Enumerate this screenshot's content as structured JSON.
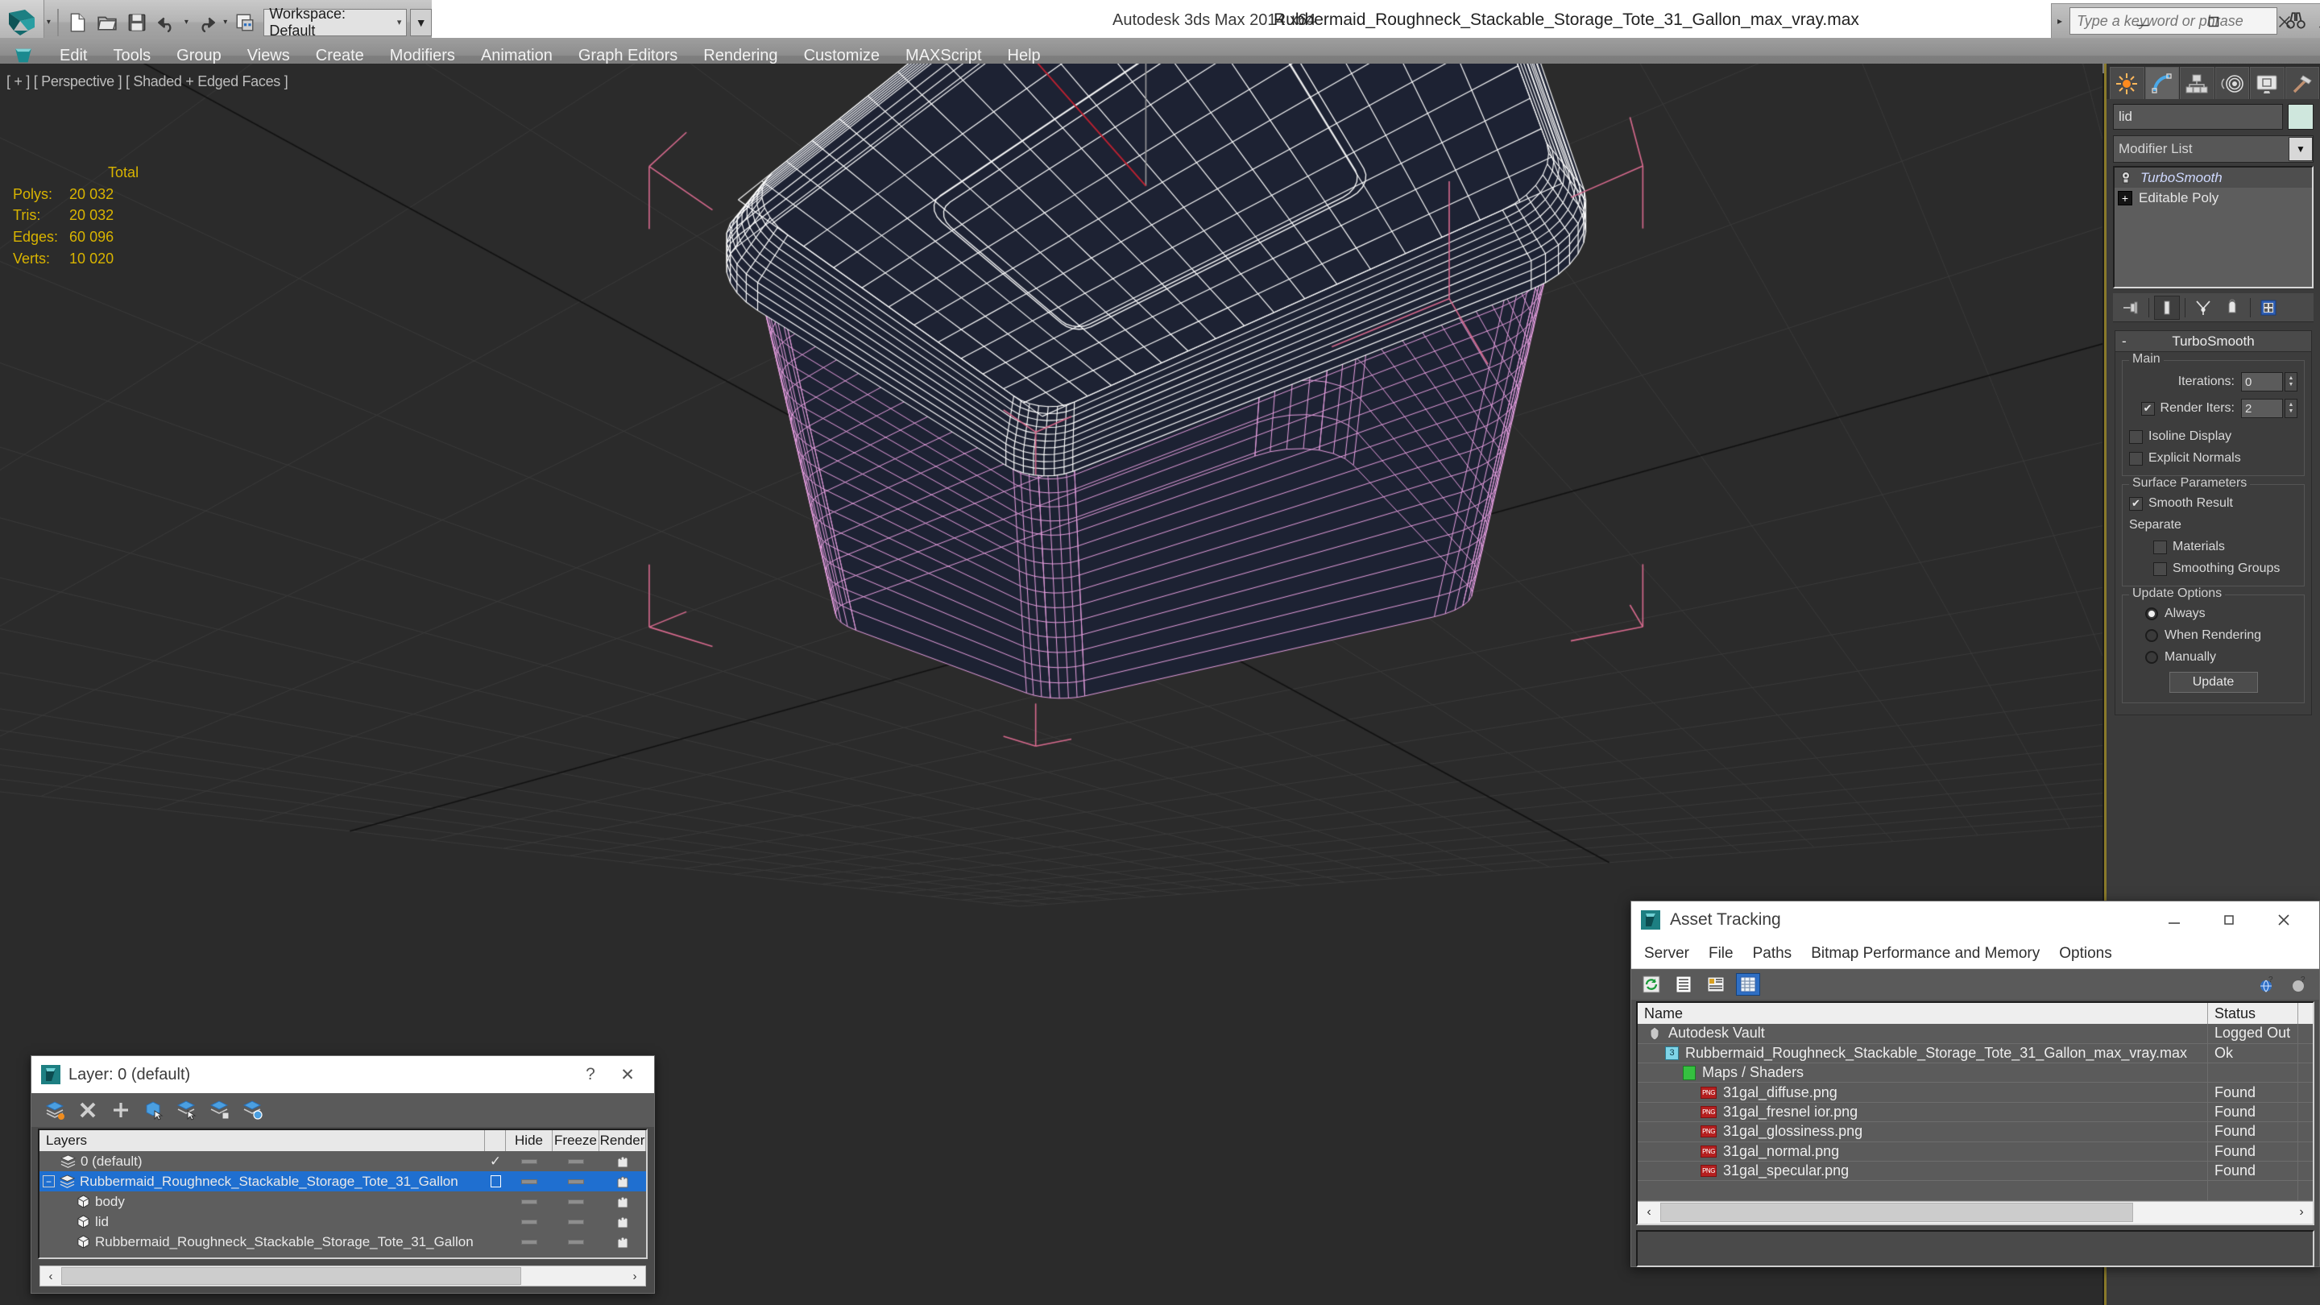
{
  "titlebar": {
    "workspace_label": "Workspace: Default",
    "app_name": "Autodesk 3ds Max  2014 x64",
    "file_name": "Rubbermaid_Roughneck_Stackable_Storage_Tote_31_Gallon_max_vray.max",
    "search_placeholder": "Type a keyword or phrase",
    "quick_access": [
      "new-icon",
      "open-icon",
      "save-icon",
      "undo-icon",
      "redo-icon",
      "set-project-icon"
    ],
    "help_icons": [
      "binoculars-icon",
      "wrench-icon",
      "satellite-icon",
      "star-icon",
      "help-icon"
    ],
    "window_controls": [
      "minimize",
      "maximize",
      "close"
    ]
  },
  "menubar": {
    "items": [
      "Edit",
      "Tools",
      "Group",
      "Views",
      "Create",
      "Modifiers",
      "Animation",
      "Graph Editors",
      "Rendering",
      "Customize",
      "MAXScript",
      "Help"
    ]
  },
  "viewport": {
    "label": "[ + ] [ Perspective ] [ Shaded + Edged Faces ]",
    "stats_header": "Total",
    "stats": [
      {
        "label": "Polys:",
        "value": "20 032"
      },
      {
        "label": "Tris:",
        "value": "20 032"
      },
      {
        "label": "Edges:",
        "value": "60 096"
      },
      {
        "label": "Verts:",
        "value": "10 020"
      }
    ],
    "colors": {
      "background": "#2b2b2b",
      "grid": "#3a3a3a",
      "selected_wire": "#ffffff",
      "object_wire": "#e79fe0",
      "surface": "#1d2233",
      "stats_text": "#d9b400",
      "gizmo_z": "#9a9a9a",
      "gizmo_y": "#c02030"
    }
  },
  "command_panel": {
    "tabs": [
      "create-icon",
      "modify-icon",
      "hierarchy-icon",
      "motion-icon",
      "display-icon",
      "utilities-icon"
    ],
    "active_tab_index": 1,
    "object_name": "lid",
    "object_color": "#cfe7dd",
    "modifier_list_label": "Modifier List",
    "stack": [
      {
        "label": "TurboSmooth",
        "selected": true,
        "icon": "lightbulb-icon"
      },
      {
        "label": "Editable Poly",
        "selected": false,
        "icon": "plus-box-icon"
      }
    ],
    "stack_buttons": [
      "pin-stack-icon",
      "show-end-result-icon",
      "make-unique-icon",
      "remove-modifier-icon",
      "configure-sets-icon"
    ],
    "rollout": {
      "title": "TurboSmooth",
      "collapse_glyph": "-",
      "groups": [
        {
          "title": "Main",
          "fields": [
            {
              "type": "spinner",
              "label": "Iterations:",
              "value": "0"
            },
            {
              "type": "check_spinner",
              "label": "Render Iters:",
              "value": "2",
              "checked": true
            },
            {
              "type": "checkbox",
              "label": "Isoline Display",
              "checked": false
            },
            {
              "type": "checkbox",
              "label": "Explicit Normals",
              "checked": false
            }
          ]
        },
        {
          "title": "Surface Parameters",
          "fields": [
            {
              "type": "checkbox",
              "label": "Smooth Result",
              "checked": true
            },
            {
              "type": "text",
              "label": "Separate"
            },
            {
              "type": "checkbox",
              "label": "Materials",
              "checked": false,
              "indent": true
            },
            {
              "type": "checkbox",
              "label": "Smoothing Groups",
              "checked": false,
              "indent": true
            }
          ]
        },
        {
          "title": "Update Options",
          "fields": [
            {
              "type": "radio",
              "label": "Always",
              "checked": true
            },
            {
              "type": "radio",
              "label": "When Rendering",
              "checked": false
            },
            {
              "type": "radio",
              "label": "Manually",
              "checked": false
            },
            {
              "type": "button",
              "label": "Update"
            }
          ]
        }
      ]
    }
  },
  "layer_dialog": {
    "title": "Layer: 0 (default)",
    "help_label": "?",
    "close_label": "✕",
    "toolbar": [
      "new-layer-icon",
      "delete-layer-icon",
      "add-layer-icon",
      "select-objects-icon",
      "select-highlighted-icon",
      "highlight-selected-icon",
      "layer-properties-icon"
    ],
    "columns": [
      "Layers",
      "",
      "Hide",
      "Freeze",
      "Render"
    ],
    "rows": [
      {
        "name": "0 (default)",
        "indent": 0,
        "selected": false,
        "current": true,
        "hide": "dash",
        "freeze": "dash",
        "render": "on",
        "icon": "layer-icon"
      },
      {
        "name": "Rubbermaid_Roughneck_Stackable_Storage_Tote_31_Gallon",
        "indent": 0,
        "selected": true,
        "current": false,
        "hide": "dash",
        "freeze": "dash",
        "render": "on",
        "icon": "layer-icon",
        "expander": "-"
      },
      {
        "name": "body",
        "indent": 1,
        "selected": false,
        "current": false,
        "hide": "dash",
        "freeze": "dash",
        "render": "on",
        "icon": "object-icon"
      },
      {
        "name": "lid",
        "indent": 1,
        "selected": false,
        "current": false,
        "hide": "dash",
        "freeze": "dash",
        "render": "on",
        "icon": "object-icon"
      },
      {
        "name": "Rubbermaid_Roughneck_Stackable_Storage_Tote_31_Gallon",
        "indent": 1,
        "selected": false,
        "current": false,
        "hide": "dash",
        "freeze": "dash",
        "render": "on",
        "icon": "object-icon"
      }
    ]
  },
  "asset_tracking": {
    "title": "Asset Tracking",
    "menu": [
      "Server",
      "File",
      "Paths",
      "Bitmap Performance and Memory",
      "Options"
    ],
    "toolbar": [
      "refresh-icon",
      "list-view-icon",
      "detail-view-icon",
      "grid-view-icon"
    ],
    "toolbar_right": [
      "help-globe-icon",
      "help-question-icon"
    ],
    "active_toolbar_index": 3,
    "columns": [
      "Name",
      "Status"
    ],
    "rows": [
      {
        "name": "Autodesk Vault",
        "status": "Logged Out",
        "indent": 0,
        "icon": "vault-icon"
      },
      {
        "name": "Rubbermaid_Roughneck_Stackable_Storage_Tote_31_Gallon_max_vray.max",
        "status": "Ok",
        "indent": 1,
        "icon": "max-file-icon"
      },
      {
        "name": "Maps / Shaders",
        "status": "",
        "indent": 2,
        "icon": "maps-icon"
      },
      {
        "name": "31gal_diffuse.png",
        "status": "Found",
        "indent": 3,
        "icon": "png-icon"
      },
      {
        "name": "31gal_fresnel ior.png",
        "status": "Found",
        "indent": 3,
        "icon": "png-icon"
      },
      {
        "name": "31gal_glossiness.png",
        "status": "Found",
        "indent": 3,
        "icon": "png-icon"
      },
      {
        "name": "31gal_normal.png",
        "status": "Found",
        "indent": 3,
        "icon": "png-icon"
      },
      {
        "name": "31gal_specular.png",
        "status": "Found",
        "indent": 3,
        "icon": "png-icon"
      }
    ]
  }
}
